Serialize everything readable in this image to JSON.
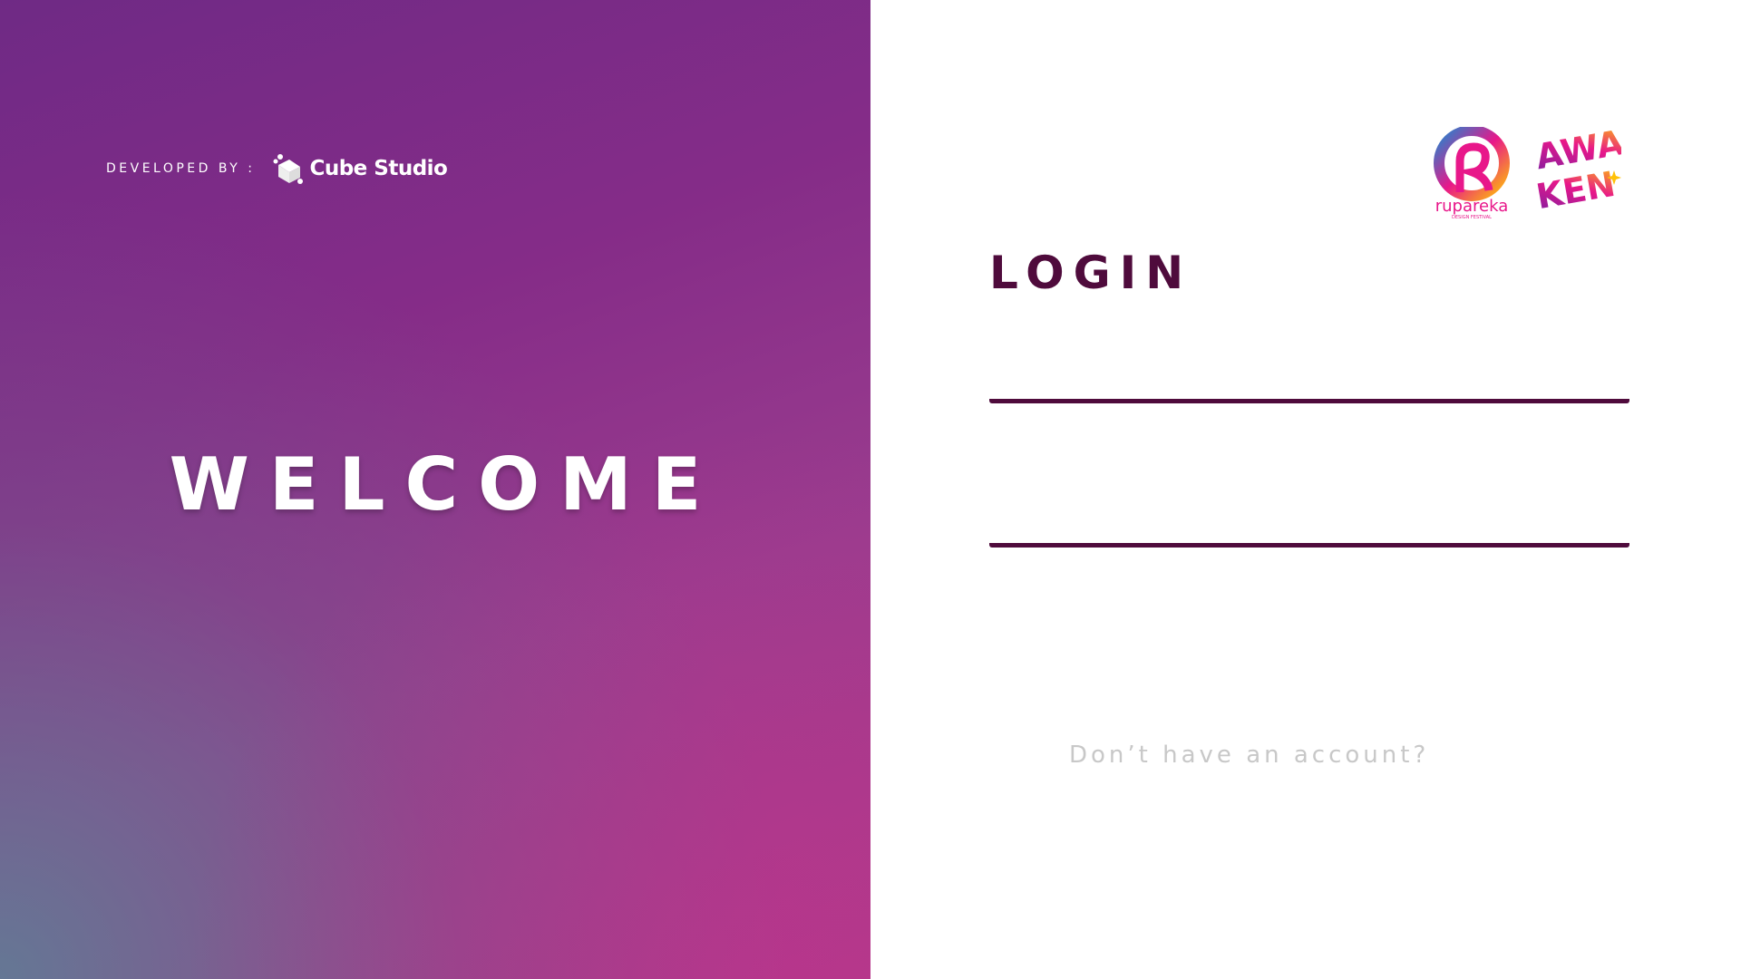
{
  "left_panel": {
    "developed_by_label": "DEVELOPED BY :",
    "developer_brand": "Cube Studio",
    "welcome": "WELCOME",
    "gradient_colors": [
      "#6f2a85",
      "#b13a8a",
      "#5f7f95"
    ]
  },
  "logos": {
    "ruparekа_text": "rupareka",
    "rupareka_subtext": "DESIGN FESTIVAL",
    "awaken_text": "AWAKEN"
  },
  "login": {
    "title": "LOGIN",
    "username_value": "",
    "password_value": "",
    "signup_prompt": "Don’t have an account?",
    "accent_color": "#4f0b3c"
  }
}
